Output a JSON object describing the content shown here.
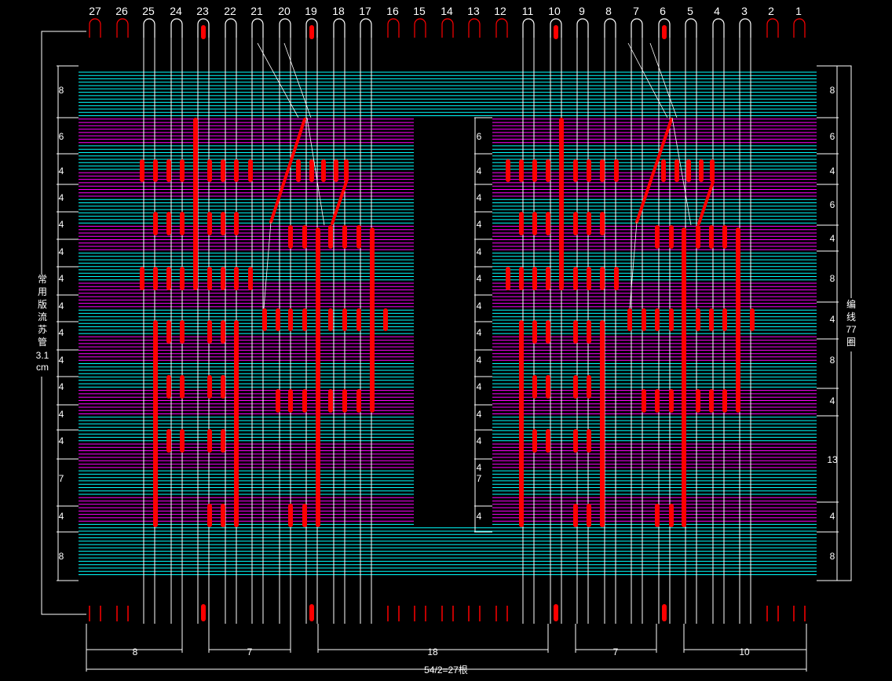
{
  "diagram": {
    "column_numbers": [
      "27",
      "26",
      "25",
      "24",
      "23",
      "22",
      "21",
      "20",
      "19",
      "18",
      "17",
      "16",
      "15",
      "14",
      "13",
      "12",
      "11",
      "10",
      "9",
      "8",
      "7",
      "6",
      "5",
      "4",
      "3",
      "2",
      "1"
    ],
    "left_label_lines": [
      "常",
      "用",
      "版",
      "流",
      "苏",
      "管",
      "3.1",
      "cm"
    ],
    "right_label_lines": [
      "编",
      "线",
      "77",
      "圈"
    ],
    "left_dims": [
      "8",
      "6",
      "4",
      "4",
      "4",
      "4",
      "4",
      "4",
      "4",
      "4",
      "4",
      "4",
      "4",
      "7",
      "4",
      "8"
    ],
    "center_dims": [
      "6",
      "4",
      "4",
      "4",
      "4",
      "4",
      "4",
      "4",
      "4",
      "4",
      "4",
      "4",
      "4",
      "7",
      "4"
    ],
    "right_dims": [
      "8",
      "6",
      "4",
      "6",
      "4",
      "8",
      "4",
      "8",
      "4",
      "13",
      "4",
      "8"
    ],
    "bottom_segments": [
      "8",
      "7",
      "18",
      "7",
      "10"
    ],
    "bottom_total": "54/2=27根",
    "colors": {
      "background": "#000000",
      "cyan": "#00ffff",
      "magenta": "#ff00ff",
      "red": "#ff0000",
      "white": "#ffffff"
    }
  }
}
